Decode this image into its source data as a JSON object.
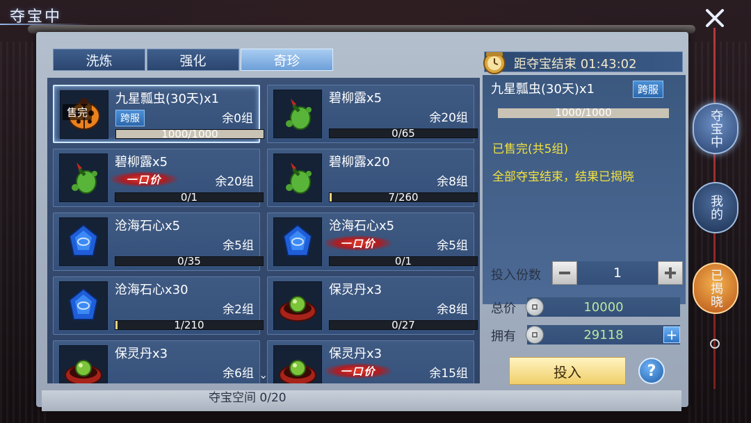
{
  "header": {
    "title": "夺宝中",
    "close_icon": "close-icon"
  },
  "tabs": [
    {
      "label": "洗炼",
      "active": false
    },
    {
      "label": "强化",
      "active": false
    },
    {
      "label": "奇珍",
      "active": true
    }
  ],
  "items": [
    {
      "name": "九星瓢虫(30天)x1",
      "remain": "余0组",
      "badge": "跨服",
      "sold_tag": "售完",
      "buy_now": "",
      "progress_text": "1000/1000",
      "progress": 1.0,
      "icon": "ladybug-icon",
      "selected": true
    },
    {
      "name": "碧柳露x5",
      "remain": "余20组",
      "badge": "",
      "sold_tag": "",
      "buy_now": "",
      "progress_text": "0/65",
      "progress": 0.0,
      "icon": "green-potion-icon",
      "selected": false
    },
    {
      "name": "碧柳露x5",
      "remain": "余20组",
      "badge": "",
      "sold_tag": "",
      "buy_now": "一口价",
      "progress_text": "0/1",
      "progress": 0.0,
      "icon": "green-potion-icon",
      "selected": false
    },
    {
      "name": "碧柳露x20",
      "remain": "余8组",
      "badge": "",
      "sold_tag": "",
      "buy_now": "",
      "progress_text": "7/260",
      "progress": 0.027,
      "icon": "green-potion-icon",
      "selected": false
    },
    {
      "name": "沧海石心x5",
      "remain": "余5组",
      "badge": "",
      "sold_tag": "",
      "buy_now": "",
      "progress_text": "0/35",
      "progress": 0.0,
      "icon": "blue-gem-icon",
      "selected": false
    },
    {
      "name": "沧海石心x5",
      "remain": "余5组",
      "badge": "",
      "sold_tag": "",
      "buy_now": "一口价",
      "progress_text": "0/1",
      "progress": 0.0,
      "icon": "blue-gem-icon",
      "selected": false
    },
    {
      "name": "沧海石心x30",
      "remain": "余2组",
      "badge": "",
      "sold_tag": "",
      "buy_now": "",
      "progress_text": "1/210",
      "progress": 0.005,
      "icon": "blue-gem-icon",
      "selected": false
    },
    {
      "name": "保灵丹x3",
      "remain": "余8组",
      "badge": "",
      "sold_tag": "",
      "buy_now": "",
      "progress_text": "0/27",
      "progress": 0.0,
      "icon": "pill-bowl-icon",
      "selected": false
    },
    {
      "name": "保灵丹x3",
      "remain": "余6组",
      "badge": "",
      "sold_tag": "",
      "buy_now": "",
      "progress_text": "",
      "progress": 0.0,
      "icon": "pill-bowl-icon",
      "selected": false
    },
    {
      "name": "保灵丹x3",
      "remain": "余15组",
      "badge": "",
      "sold_tag": "",
      "buy_now": "一口价",
      "progress_text": "",
      "progress": 0.0,
      "icon": "pill-bowl-icon",
      "selected": false
    }
  ],
  "footer": {
    "space_info": "夺宝空间 0/20"
  },
  "detail": {
    "timer": "距夺宝结束 01:43:02",
    "name": "九星瓢虫(30天)x1",
    "badge": "跨服",
    "progress_text": "1000/1000",
    "progress": 1.0,
    "status_sold": "已售完(共5组)",
    "status_result": "全部夺宝结束，结果已揭晓",
    "qty_label": "投入份数",
    "qty_value": "1",
    "total_label": "总价",
    "total_value": "10000",
    "own_label": "拥有",
    "own_value": "29118",
    "invest_label": "投入",
    "help_label": "?"
  },
  "side_nav": [
    {
      "label": "夺宝中",
      "state": "active"
    },
    {
      "label": "我的",
      "state": "normal"
    },
    {
      "label": "已揭晓",
      "state": "revealed"
    }
  ],
  "colors": {
    "status_yellow": "#f3e23e",
    "price_green": "#b8e8a3",
    "invest_gold": "#f0cf6a"
  }
}
